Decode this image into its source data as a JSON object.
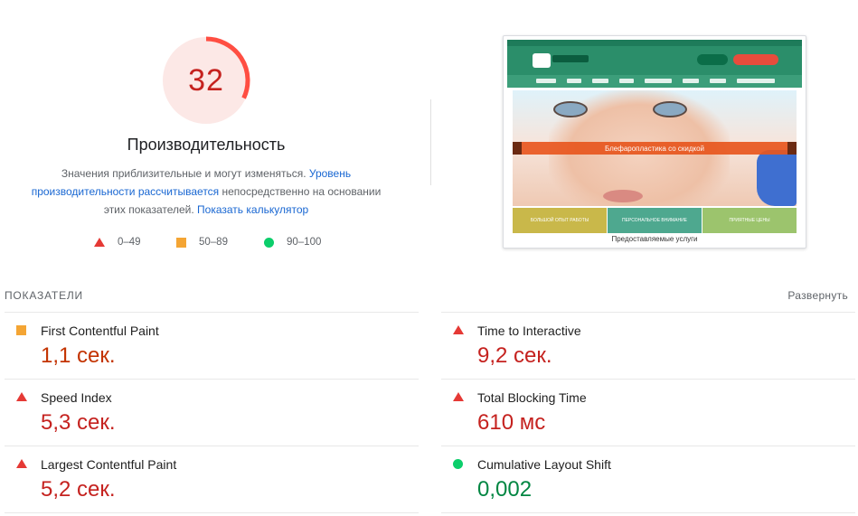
{
  "score": {
    "value": "32",
    "fraction": 0.32,
    "color": "#ff4e42",
    "background": "#fce8e6",
    "title": "Производительность",
    "description_part1": "Значения приблизительные и могут изменяться. ",
    "link1": "Уровень производительности рассчитывается",
    "description_part2": " непосредственно на основании этих показателей. ",
    "link2": "Показать калькулятор"
  },
  "legend": [
    {
      "icon": "triangle-icon",
      "color": "#e53935",
      "label": "0–49"
    },
    {
      "icon": "square-icon",
      "color": "#f4a534",
      "label": "50–89"
    },
    {
      "icon": "circle-icon",
      "color": "#0cce6b",
      "label": "90–100"
    }
  ],
  "metrics_header": {
    "label": "ПОКАЗАТЕЛИ",
    "expand": "Развернуть"
  },
  "metrics": [
    {
      "name": "First Contentful Paint",
      "value": "1,1 сек.",
      "status": "average",
      "icon": "square-icon"
    },
    {
      "name": "Time to Interactive",
      "value": "9,2 сек.",
      "status": "fail",
      "icon": "triangle-icon"
    },
    {
      "name": "Speed Index",
      "value": "5,3 сек.",
      "status": "fail",
      "icon": "triangle-icon"
    },
    {
      "name": "Total Blocking Time",
      "value": "610 мс",
      "status": "fail",
      "icon": "triangle-icon"
    },
    {
      "name": "Largest Contentful Paint",
      "value": "5,2 сек.",
      "status": "fail",
      "icon": "triangle-icon"
    },
    {
      "name": "Cumulative Layout Shift",
      "value": "0,002",
      "status": "pass",
      "icon": "circle-icon"
    }
  ],
  "screenshot": {
    "banner_text": "Блефаропластика со скидкой",
    "features": [
      "БОЛЬШОЙ ОПЫТ РАБОТЫ",
      "ПЕРСОНАЛЬНОЕ ВНИМАНИЕ",
      "ПРИЯТНЫЕ ЦЕНЫ"
    ],
    "services_heading": "Предоставляемые услуги"
  }
}
